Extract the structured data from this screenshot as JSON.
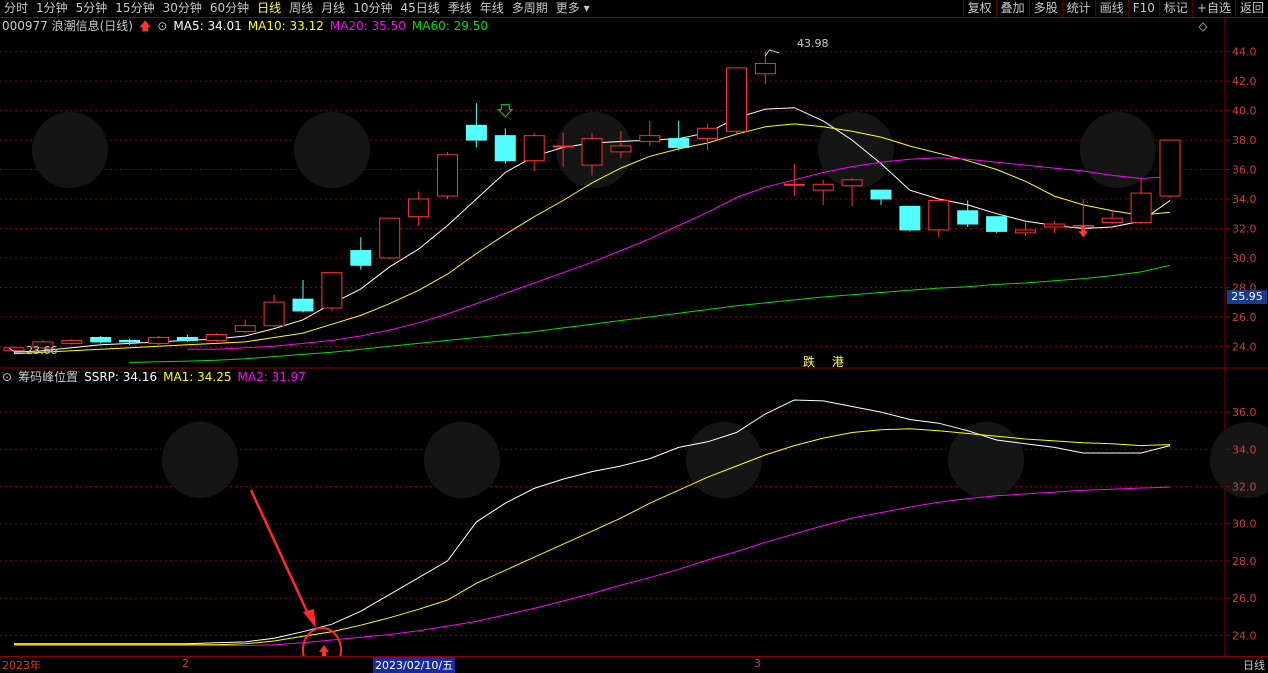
{
  "toolbar": {
    "items": [
      "分时",
      "1分钟",
      "5分钟",
      "15分钟",
      "30分钟",
      "60分钟",
      "日线",
      "周线",
      "月线",
      "10分钟",
      "45日线",
      "季线",
      "年线",
      "多周期",
      "更多"
    ],
    "active_index": 6,
    "right_items": [
      "复权",
      "叠加",
      "多股",
      "统计",
      "画线",
      "F10",
      "标记",
      "+自选",
      "返回"
    ]
  },
  "main_info": {
    "code_name": "000977 浪潮信息(日线)",
    "ma5": "MA5: 34.01",
    "ma10": "MA10: 33.12",
    "ma20": "MA20: 35.50",
    "ma60": "MA60: 29.50"
  },
  "sub_info": {
    "name": "筹码峰位置",
    "ssrp": "SSRP: 34.16",
    "ma1": "MA1: 34.25",
    "ma2": "MA2: 31.97"
  },
  "annotations": {
    "high_label": "43.98",
    "low_label": "23.66",
    "price_box": "25.95",
    "tag1": "跌",
    "tag2": "港",
    "xaxis_year": "2023年",
    "xaxis_m2": "2",
    "xaxis_date": "2023/02/10/五",
    "xaxis_m3": "3",
    "period_label": "日线"
  },
  "colors": {
    "up": "#ff3232",
    "down": "#54ffff",
    "ma5": "#ffffff",
    "ma10": "#ffff00",
    "ma20": "#ff00ff",
    "ma60": "#00e000",
    "grid": "#8b0000"
  },
  "chart_data": [
    {
      "type": "candlestick",
      "title": "000977 浪潮信息(日线)",
      "ylim": [
        22.8,
        45.2
      ],
      "yticks": [
        24.0,
        26.0,
        28.0,
        30.0,
        32.0,
        34.0,
        36.0,
        38.0,
        40.0,
        42.0,
        44.0
      ],
      "candles": [
        {
          "o": 23.7,
          "c": 23.9,
          "h": 24.0,
          "l": 23.66
        },
        {
          "o": 23.9,
          "c": 24.3,
          "h": 24.4,
          "l": 23.8
        },
        {
          "o": 24.2,
          "c": 24.4,
          "h": 24.5,
          "l": 24.1
        },
        {
          "o": 24.6,
          "c": 24.3,
          "h": 24.7,
          "l": 24.2
        },
        {
          "o": 24.4,
          "c": 24.3,
          "h": 24.5,
          "l": 24.1
        },
        {
          "o": 24.2,
          "c": 24.6,
          "h": 24.7,
          "l": 24.1
        },
        {
          "o": 24.6,
          "c": 24.4,
          "h": 24.8,
          "l": 24.3
        },
        {
          "o": 24.4,
          "c": 24.8,
          "h": 24.9,
          "l": 24.3
        },
        {
          "o": 25.0,
          "c": 25.4,
          "h": 25.8,
          "l": 24.9
        },
        {
          "o": 25.4,
          "c": 27.0,
          "h": 27.5,
          "l": 25.3
        },
        {
          "o": 27.2,
          "c": 26.4,
          "h": 28.5,
          "l": 26.3
        },
        {
          "o": 26.6,
          "c": 29.0,
          "h": 29.0,
          "l": 26.4
        },
        {
          "o": 30.5,
          "c": 29.5,
          "h": 31.4,
          "l": 29.2
        },
        {
          "o": 30.0,
          "c": 32.7,
          "h": 32.7,
          "l": 29.9
        },
        {
          "o": 32.8,
          "c": 34.0,
          "h": 34.5,
          "l": 32.2
        },
        {
          "o": 34.2,
          "c": 37.0,
          "h": 37.2,
          "l": 34.0
        },
        {
          "o": 39.0,
          "c": 38.0,
          "h": 40.5,
          "l": 37.5
        },
        {
          "o": 38.3,
          "c": 36.6,
          "h": 38.8,
          "l": 36.4
        },
        {
          "o": 36.6,
          "c": 38.3,
          "h": 38.5,
          "l": 35.9
        },
        {
          "o": 37.6,
          "c": 37.6,
          "h": 38.5,
          "l": 36.2
        },
        {
          "o": 36.3,
          "c": 38.1,
          "h": 38.5,
          "l": 35.6
        },
        {
          "o": 37.2,
          "c": 37.6,
          "h": 38.6,
          "l": 36.8
        },
        {
          "o": 37.9,
          "c": 38.3,
          "h": 39.3,
          "l": 37.6
        },
        {
          "o": 38.1,
          "c": 37.5,
          "h": 39.3,
          "l": 37.3
        },
        {
          "o": 38.1,
          "c": 38.8,
          "h": 39.1,
          "l": 37.3
        },
        {
          "o": 38.6,
          "c": 42.9,
          "h": 42.9,
          "l": 38.4
        },
        {
          "o": 42.5,
          "c": 43.2,
          "h": 43.98,
          "l": 41.8
        },
        {
          "o": 35.0,
          "c": 35.0,
          "h": 36.4,
          "l": 34.2
        },
        {
          "o": 34.6,
          "c": 35.0,
          "h": 35.3,
          "l": 33.6
        },
        {
          "o": 34.9,
          "c": 35.3,
          "h": 35.4,
          "l": 33.5
        },
        {
          "o": 34.6,
          "c": 34.0,
          "h": 34.6,
          "l": 33.6
        },
        {
          "o": 33.5,
          "c": 31.9,
          "h": 33.5,
          "l": 31.8
        },
        {
          "o": 31.9,
          "c": 33.9,
          "h": 33.9,
          "l": 31.4
        },
        {
          "o": 33.2,
          "c": 32.3,
          "h": 33.9,
          "l": 32.1
        },
        {
          "o": 32.8,
          "c": 31.8,
          "h": 32.8,
          "l": 31.7
        },
        {
          "o": 31.7,
          "c": 31.9,
          "h": 32.4,
          "l": 31.5
        },
        {
          "o": 32.1,
          "c": 32.3,
          "h": 32.5,
          "l": 31.7
        },
        {
          "o": 32.1,
          "c": 32.2,
          "h": 34.0,
          "l": 31.7
        },
        {
          "o": 32.4,
          "c": 32.7,
          "h": 33.2,
          "l": 32.3
        },
        {
          "o": 32.4,
          "c": 34.4,
          "h": 35.4,
          "l": 32.3
        },
        {
          "o": 34.2,
          "c": 38.0,
          "h": 38.0,
          "l": 34.1
        }
      ],
      "series": [
        {
          "name": "MA5",
          "values": [
            23.6,
            23.7,
            23.9,
            24.1,
            24.2,
            24.3,
            24.4,
            24.5,
            24.7,
            25.2,
            25.8,
            26.9,
            27.9,
            29.4,
            30.6,
            32.2,
            34.0,
            35.8,
            36.9,
            37.5,
            37.8,
            37.9,
            38.0,
            38.1,
            38.5,
            39.5,
            40.1,
            40.2,
            39.3,
            38.0,
            36.4,
            34.6,
            34.0,
            33.6,
            33.0,
            32.5,
            32.2,
            32.0,
            32.1,
            32.5,
            33.9
          ]
        },
        {
          "name": "MA10",
          "values": [
            23.5,
            23.6,
            23.7,
            23.8,
            23.9,
            24.0,
            24.1,
            24.2,
            24.3,
            24.6,
            24.9,
            25.5,
            26.1,
            26.9,
            27.8,
            28.9,
            30.3,
            31.6,
            32.8,
            33.9,
            35.1,
            36.1,
            36.9,
            37.4,
            37.8,
            38.4,
            38.9,
            39.1,
            38.9,
            38.6,
            38.2,
            37.6,
            37.1,
            36.6,
            36.0,
            35.2,
            34.2,
            33.6,
            33.2,
            32.9,
            33.1
          ]
        },
        {
          "name": "MA20",
          "values": [
            null,
            null,
            null,
            null,
            null,
            null,
            23.8,
            23.8,
            23.9,
            24.0,
            24.2,
            24.4,
            24.7,
            25.1,
            25.6,
            26.2,
            26.9,
            27.6,
            28.3,
            29.0,
            29.7,
            30.5,
            31.3,
            32.2,
            33.1,
            34.1,
            34.8,
            35.3,
            35.8,
            36.2,
            36.5,
            36.7,
            36.8,
            36.7,
            36.5,
            36.3,
            36.1,
            35.9,
            35.6,
            35.4,
            35.5
          ]
        },
        {
          "name": "MA60",
          "values": [
            null,
            null,
            null,
            null,
            22.9,
            22.95,
            23.0,
            23.05,
            23.15,
            23.3,
            23.45,
            23.6,
            23.8,
            24.0,
            24.2,
            24.4,
            24.6,
            24.8,
            25.0,
            25.25,
            25.5,
            25.75,
            26.0,
            26.25,
            26.5,
            26.75,
            26.95,
            27.15,
            27.35,
            27.5,
            27.65,
            27.8,
            27.95,
            28.05,
            28.2,
            28.3,
            28.45,
            28.6,
            28.8,
            29.05,
            29.5
          ]
        }
      ],
      "annotations": [
        {
          "text": "43.98",
          "index": 26,
          "value": 43.98
        },
        {
          "text": "23.66",
          "index": 0,
          "value": 23.66
        },
        {
          "text": "25.95",
          "value": 25.95
        }
      ]
    },
    {
      "type": "line",
      "title": "筹码峰位置",
      "ylim": [
        23.0,
        37.4
      ],
      "yticks": [
        24.0,
        26.0,
        28.0,
        30.0,
        32.0,
        34.0,
        36.0
      ],
      "series": [
        {
          "name": "SSRP",
          "values": [
            23.55,
            23.55,
            23.55,
            23.55,
            23.55,
            23.55,
            23.55,
            23.6,
            23.65,
            23.85,
            24.2,
            24.6,
            25.3,
            26.2,
            27.1,
            28.0,
            30.1,
            31.1,
            31.9,
            32.4,
            32.8,
            33.1,
            33.5,
            34.1,
            34.4,
            34.9,
            35.9,
            36.65,
            36.6,
            36.3,
            36.0,
            35.6,
            35.4,
            35.0,
            34.5,
            34.3,
            34.1,
            33.8,
            33.8,
            33.8,
            34.2
          ]
        },
        {
          "name": "MA1",
          "values": [
            23.5,
            23.5,
            23.5,
            23.5,
            23.5,
            23.5,
            23.5,
            23.5,
            23.55,
            23.7,
            23.95,
            24.2,
            24.55,
            24.95,
            25.4,
            25.9,
            26.8,
            27.5,
            28.2,
            28.9,
            29.6,
            30.3,
            31.1,
            31.8,
            32.5,
            33.1,
            33.7,
            34.2,
            34.6,
            34.9,
            35.05,
            35.1,
            35.0,
            34.85,
            34.7,
            34.55,
            34.45,
            34.35,
            34.3,
            34.2,
            34.25
          ]
        },
        {
          "name": "MA2",
          "values": [
            23.45,
            23.45,
            23.45,
            23.45,
            23.45,
            23.45,
            23.45,
            23.45,
            23.45,
            23.5,
            23.6,
            23.75,
            23.9,
            24.05,
            24.25,
            24.5,
            24.75,
            25.1,
            25.45,
            25.85,
            26.25,
            26.7,
            27.1,
            27.55,
            28.05,
            28.5,
            29.0,
            29.45,
            29.9,
            30.3,
            30.6,
            30.9,
            31.15,
            31.35,
            31.5,
            31.6,
            31.7,
            31.8,
            31.85,
            31.92,
            31.97
          ]
        }
      ]
    }
  ]
}
